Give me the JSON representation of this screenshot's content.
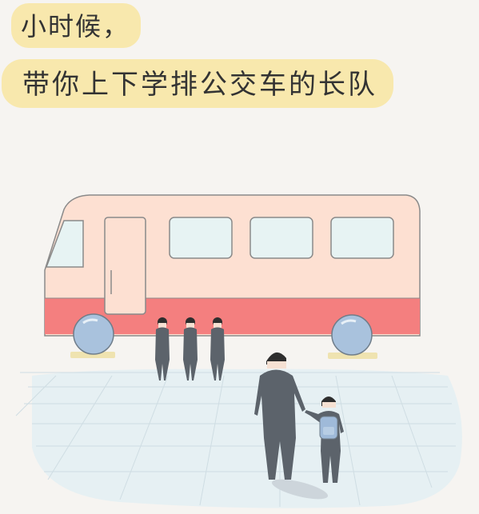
{
  "caption": {
    "line1": "小时候，",
    "line2": "带你上下学排公交车的长队"
  },
  "colors": {
    "background": "#f6f4f1",
    "highlight": "#f8e8ad",
    "bus_body": "#fde0d2",
    "bus_stripe": "#f47f7f",
    "window": "#e7f3f3",
    "wheel": "#a9c2dd",
    "ground": "#e6f0f3",
    "figure": "#5c636b",
    "backpack": "#9fbad9"
  },
  "scene": {
    "icons": [
      "bus-illustration",
      "waiting-passengers",
      "parent-figure",
      "child-figure",
      "backpack"
    ]
  }
}
